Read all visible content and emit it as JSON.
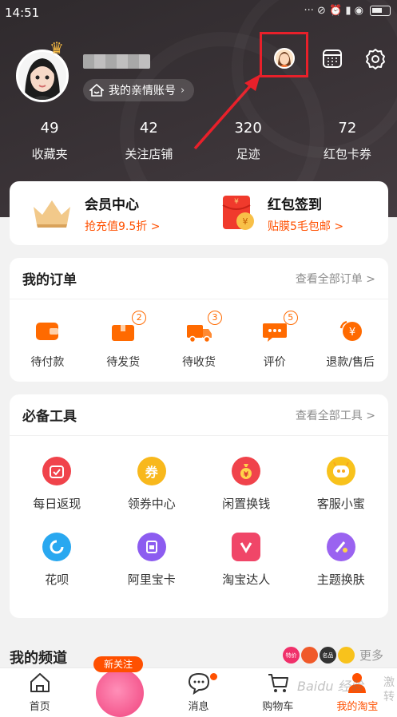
{
  "status_bar": {
    "time": "14:51",
    "icons": "··· ⊘ ⏰ ▮ ◉"
  },
  "header": {
    "family_account": "我的亲情账号",
    "stats": [
      {
        "value": "49",
        "label": "收藏夹"
      },
      {
        "value": "42",
        "label": "关注店铺"
      },
      {
        "value": "320",
        "label": "足迹"
      },
      {
        "value": "72",
        "label": "红包卡券"
      }
    ],
    "icons": [
      "account-switch-icon",
      "calendar-icon",
      "settings-icon"
    ]
  },
  "vip": {
    "member_title": "会员中心",
    "member_sub": "抢充值9.5折 >",
    "signin_title": "红包签到",
    "signin_sub": "贴膜5毛包邮 >"
  },
  "orders": {
    "title": "我的订单",
    "more": "查看全部订单 >",
    "items": [
      {
        "label": "待付款",
        "badge": ""
      },
      {
        "label": "待发货",
        "badge": "2"
      },
      {
        "label": "待收货",
        "badge": "3"
      },
      {
        "label": "评价",
        "badge": "5"
      },
      {
        "label": "退款/售后",
        "badge": ""
      }
    ]
  },
  "tools": {
    "title": "必备工具",
    "more": "查看全部工具 >",
    "items": [
      {
        "label": "每日返现",
        "glyph": "",
        "color": "#f0434b"
      },
      {
        "label": "领券中心",
        "glyph": "券",
        "color": "#f8b81c"
      },
      {
        "label": "闲置换钱",
        "glyph": "",
        "color": "#f0434b"
      },
      {
        "label": "客服小蜜",
        "glyph": "",
        "color": "#f8c21c"
      },
      {
        "label": "花呗",
        "glyph": "",
        "color": "#29a8f0"
      },
      {
        "label": "阿里宝卡",
        "glyph": "",
        "color": "#8c5cf0"
      },
      {
        "label": "淘宝达人",
        "glyph": "",
        "color": "#f04668"
      },
      {
        "label": "主题换肤",
        "glyph": "",
        "color": "#9a63f0"
      }
    ]
  },
  "channel": {
    "title": "我的频道",
    "badges": [
      {
        "text": "特价",
        "color": "#f0306a"
      },
      {
        "text": "",
        "color": "#f05a2a"
      },
      {
        "text": "名品",
        "color": "#333333"
      },
      {
        "text": "",
        "color": "#f8c21c"
      }
    ],
    "more": "更多 >"
  },
  "tabbar": {
    "new_follow": "新关注",
    "tabs": [
      {
        "label": "首页"
      },
      {
        "label": ""
      },
      {
        "label": "消息"
      },
      {
        "label": "购物车"
      },
      {
        "label": "我的淘宝"
      }
    ]
  },
  "watermark": {
    "text": "Baidu 经验",
    "side": "激转"
  },
  "colors": {
    "accent": "#ff5000",
    "header_bg": "#3a3337",
    "highlight": "#e8202a"
  }
}
